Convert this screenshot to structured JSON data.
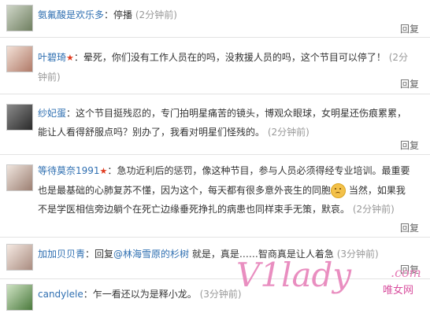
{
  "comments": [
    {
      "name": "氨氟酸是欢乐多",
      "star": false,
      "text": "停播",
      "time": "(2分钟前)",
      "reply": "回复"
    },
    {
      "name": "叶碧琦",
      "star": true,
      "text": "晕死，你们没有工作人员在的吗，没救援人员的吗，这个节目可以停了！",
      "time": "(2分钟前)",
      "reply": "回复"
    },
    {
      "name": "纱妃蛋",
      "star": false,
      "text": "这个节目挺残忍的，专门拍明星痛苦的镜头，博观众眼球，女明星还伤痕累累，能让人看得舒服点吗？别办了，我看对明星们怪残的。",
      "time": "(2分钟前)",
      "reply": "回复"
    },
    {
      "name": "等待莫奈1991",
      "star": true,
      "text_a": "急功近利后的惩罚，像这种节目，参与人员必须得经专业培训。最重要也是最基础的心肺复苏不懂，因为这个，每天都有很多意外丧生的同胞",
      "text_b": "当然，如果我不是学医相信旁边躺个在死亡边缘垂死挣扎的病患也同样束手无策，默哀。",
      "time": "(2分钟前)",
      "reply": "回复"
    },
    {
      "name": "加加贝贝青",
      "star": false,
      "text_a": "回复",
      "mention": "@林海雪原的杉树",
      "text_b": "就是，真是……智商真是让人着急",
      "time": "(3分钟前)",
      "reply": "回复"
    },
    {
      "name": "candylele",
      "star": false,
      "text": "乍一看还以为是释小龙。",
      "time": "(3分钟前)",
      "reply": ""
    }
  ],
  "watermark": {
    "main": "V1lady",
    "com": ".com",
    "cn": "唯女网"
  }
}
